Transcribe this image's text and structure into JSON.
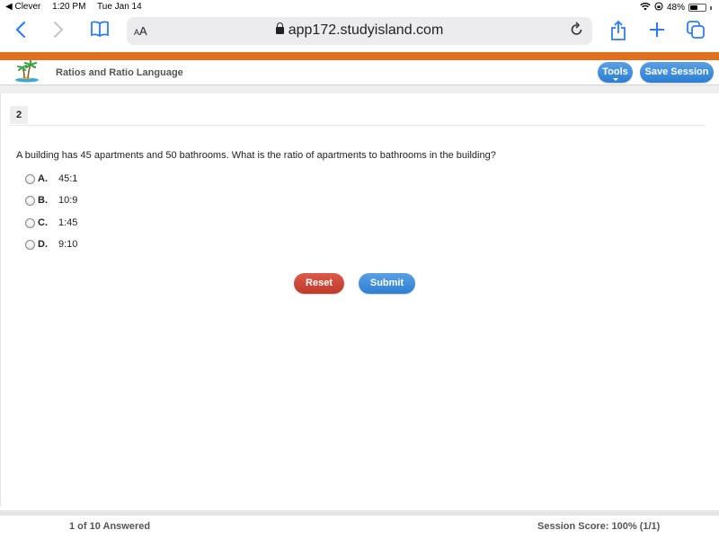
{
  "status_bar": {
    "back_app": "◀ Clever",
    "time": "1:20 PM",
    "date": "Tue Jan 14",
    "battery": "48%"
  },
  "browser": {
    "text_size_label": "AA",
    "url": "app172.studyisland.com",
    "icons": [
      "back-icon",
      "forward-icon",
      "bookmarks-icon",
      "lock-icon",
      "reload-icon",
      "share-icon",
      "new-tab-icon",
      "tabs-icon"
    ]
  },
  "app": {
    "title": "Ratios and Ratio Language",
    "tools_label": "Tools",
    "save_session_label": "Save Session",
    "accent_orange": "#e07020",
    "accent_blue": "#2c7fd3"
  },
  "question": {
    "number": "2",
    "text": "A building has 45 apartments and 50 bathrooms. What is the ratio of apartments to bathrooms in the building?",
    "choices": [
      {
        "letter": "A.",
        "text": "45:1"
      },
      {
        "letter": "B.",
        "text": "10:9"
      },
      {
        "letter": "C.",
        "text": "1:45"
      },
      {
        "letter": "D.",
        "text": "9:10"
      }
    ],
    "reset_label": "Reset",
    "submit_label": "Submit"
  },
  "footer": {
    "answered": "1 of 10 Answered",
    "score": "Session Score: 100% (1/1)"
  }
}
